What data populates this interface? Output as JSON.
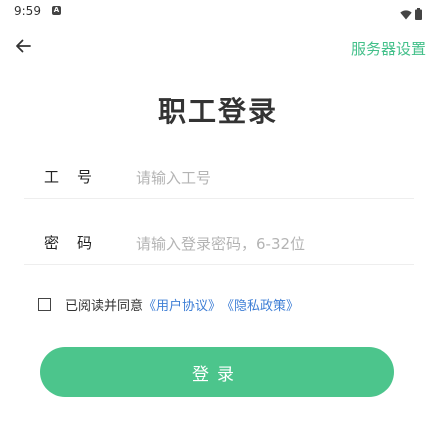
{
  "status_bar": {
    "time": "9:59",
    "notification_glyph": "A",
    "icons": [
      "wifi-icon",
      "battery-icon"
    ]
  },
  "topbar": {
    "back_icon": "arrow-left-icon",
    "server_settings_label": "服务器设置"
  },
  "title": "职工登录",
  "form": {
    "employee_id": {
      "label": "工号",
      "placeholder": "请输入工号",
      "value": ""
    },
    "password": {
      "label": "密码",
      "placeholder": "请输入登录密码，6-32位",
      "value": ""
    }
  },
  "agreement": {
    "checked": false,
    "prefix": "已阅读并同意",
    "user_agreement": "《用户协议》",
    "privacy_policy": "《隐私政策》"
  },
  "login_button_label": "登录",
  "colors": {
    "accent": "#43c08a",
    "button": "#4cc58c",
    "link": "#3f7fd6"
  }
}
